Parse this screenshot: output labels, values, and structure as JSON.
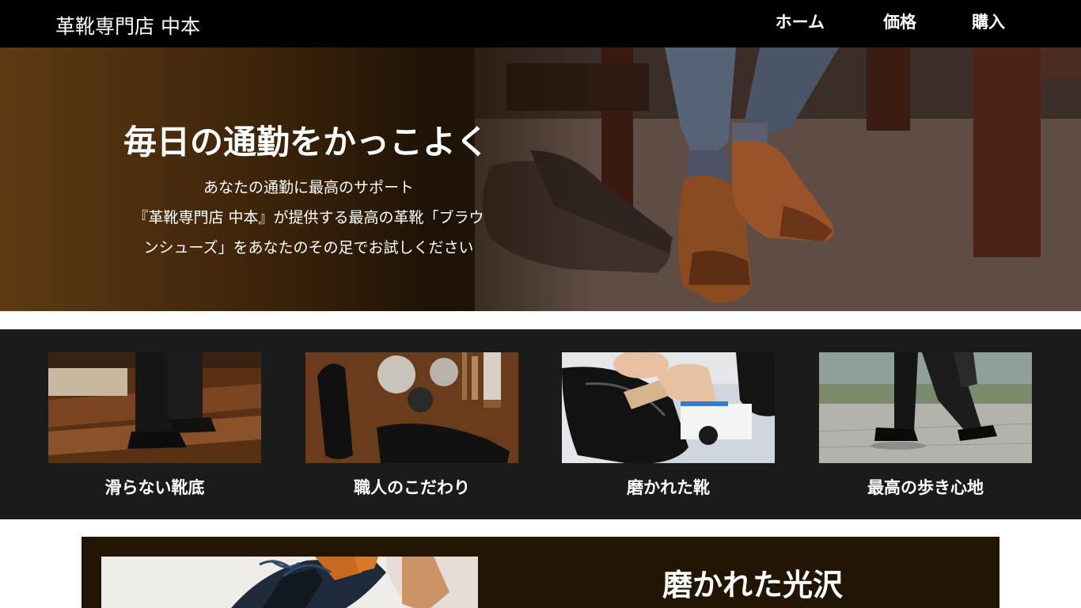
{
  "header": {
    "logo": "革靴専門店 中本",
    "nav": [
      "ホーム",
      "価格",
      "購入"
    ]
  },
  "hero": {
    "title": "毎日の通勤をかっこよく",
    "lines": [
      "あなたの通勤に最高のサポート",
      "『革靴専門店 中本』が提供する最高の革靴「ブラウ",
      "ンシューズ」をあなたのその足でお試しください"
    ]
  },
  "features": [
    {
      "caption": "滑らない靴底",
      "image": "walking-shoes-wood-floor-photo"
    },
    {
      "caption": "職人のこだわり",
      "image": "shoes-and-care-tools-photo"
    },
    {
      "caption": "磨かれた靴",
      "image": "polishing-shoe-photo"
    },
    {
      "caption": "最高の歩き心地",
      "image": "walking-street-photo"
    }
  ],
  "gloss": {
    "title": "磨かれた光沢",
    "image": "polished-shoes-photo"
  },
  "colors": {
    "header_bg": "#000000",
    "features_bg": "#1b1b1b",
    "gloss_bg": "#231504"
  }
}
